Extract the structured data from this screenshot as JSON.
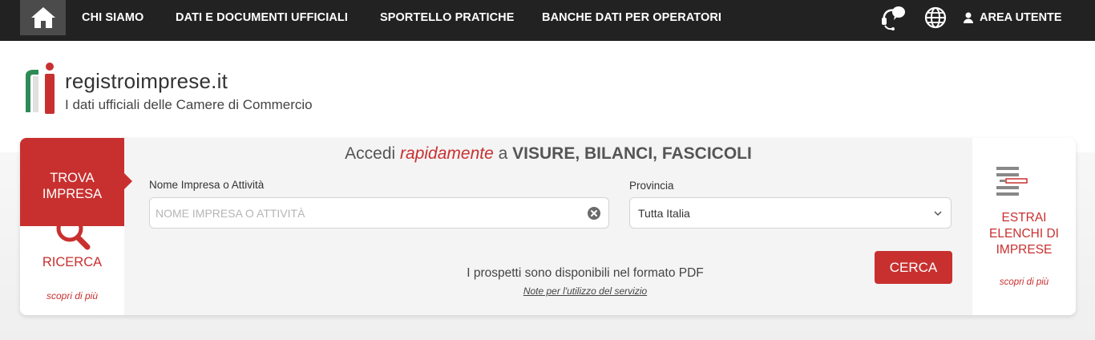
{
  "nav": {
    "home_icon": "home-icon",
    "links": [
      "CHI SIAMO",
      "DATI E DOCUMENTI UFFICIALI",
      "SPORTELLO PRATICHE",
      "BANCHE DATI PER OPERATORI"
    ],
    "support_icon": "headset-chat-icon",
    "language_icon": "globe-icon",
    "user_icon": "user-icon",
    "user_label": "AREA UTENTE"
  },
  "logo": {
    "title": "registroimprese.it",
    "subtitle": "I dati ufficiali delle Camere di Commercio"
  },
  "search": {
    "tab_line1": "TROVA",
    "tab_line2": "IMPRESA",
    "ricerca_label": "RICERCA",
    "scopri_left": "scopri di più",
    "headline_prefix": "Accedi ",
    "headline_emphasis": "rapidamente",
    "headline_middle": " a ",
    "headline_strong": "VISURE, BILANCI, FASCICOLI",
    "name_label": "Nome Impresa o Attività",
    "name_placeholder": "NOME IMPRESA O ATTIVITÀ",
    "name_value": "",
    "province_label": "Provincia",
    "province_value": "Tutta Italia",
    "pdf_note": "I prospetti sono disponibili nel formato PDF",
    "usage_link": "Note per l'utilizzo del servizio",
    "submit_label": "CERCA"
  },
  "extract": {
    "line1": "ESTRAI",
    "line2": "ELENCHI DI",
    "line3": "IMPRESE",
    "scopri_right": "scopri di più"
  },
  "colors": {
    "nav_bg": "#222222",
    "accent_red": "#c8302f",
    "logo_green": "#2e8b57",
    "panel_bg": "#f4f4f4"
  }
}
